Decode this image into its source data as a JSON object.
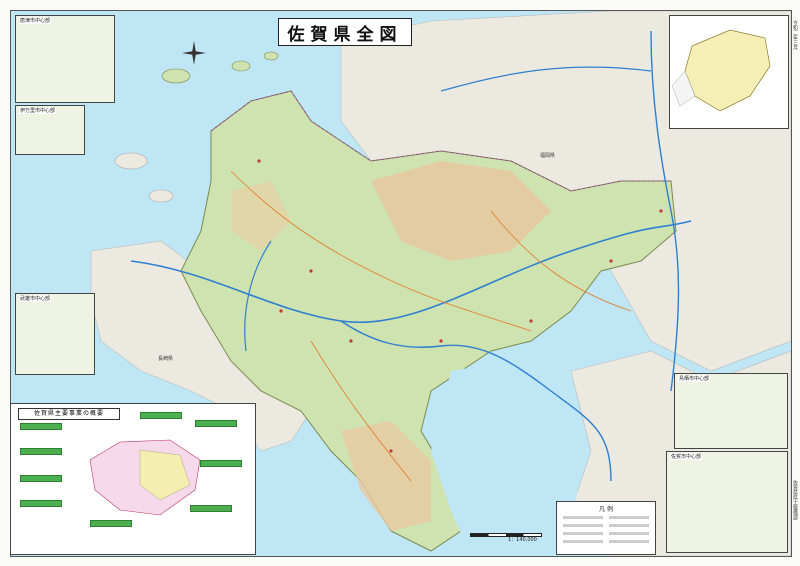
{
  "map": {
    "title": "佐賀県全図",
    "regions": {
      "fukuoka": "福岡県",
      "nagasaki": "長崎県"
    },
    "bay_label": "1：140,000",
    "legend_title": "凡 例",
    "major_project_title": "佐賀県主要事業の概要",
    "inset_captions": [
      "唐津市中心部",
      "伊万里市中心部",
      "武雄市中心部",
      "鳥栖市中心部",
      "佐賀市中心部"
    ],
    "side_note": "令和二年三月",
    "side_note2": "佐賀県県土整備部",
    "colors": {
      "sea": "#bfe6f5",
      "land_green": "#cfe3b0",
      "land_mountain": "#e8c8a0",
      "expressway": "#2f7fd0",
      "prefecture_bg": "#eceae0"
    },
    "icons": [
      "compass-rose-icon"
    ]
  }
}
